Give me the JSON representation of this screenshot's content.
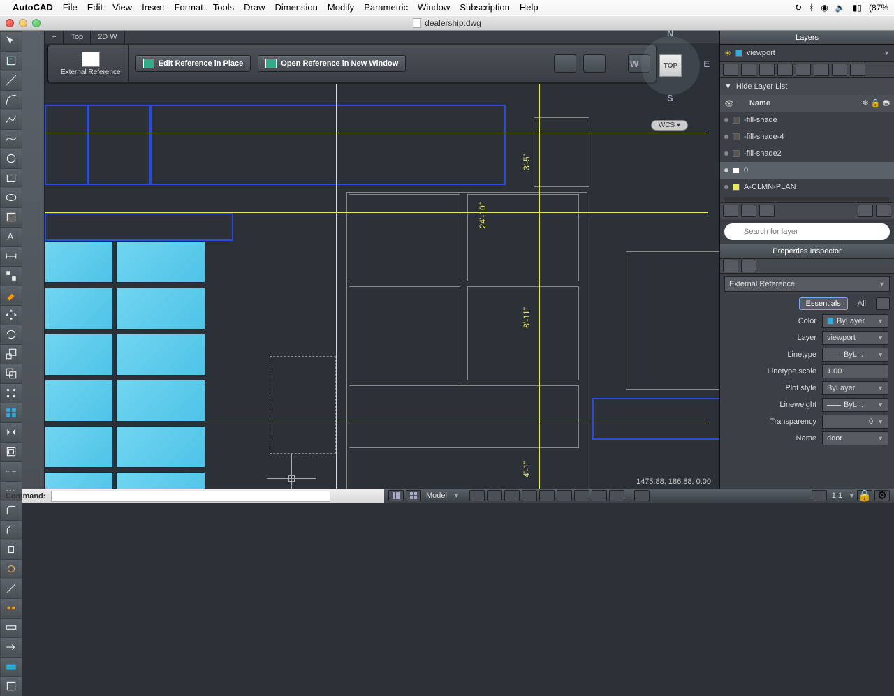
{
  "mac_menu": {
    "app": "AutoCAD",
    "items": [
      "File",
      "Edit",
      "View",
      "Insert",
      "Format",
      "Tools",
      "Draw",
      "Dimension",
      "Modify",
      "Parametric",
      "Window",
      "Subscription",
      "Help"
    ],
    "battery": "(87%"
  },
  "window": {
    "filename": "dealership.dwg"
  },
  "tabs": {
    "add": "+",
    "t1": "Top",
    "t2": "2D W"
  },
  "ref_bar": {
    "group_label": "External Reference",
    "edit_in_place": "Edit Reference in Place",
    "open_new_window": "Open Reference in New Window"
  },
  "viewcube": {
    "top": "TOP",
    "n": "N",
    "s": "S",
    "e": "E",
    "w": "W",
    "wcs": "WCS"
  },
  "coord": "1475.88, 186.88, 0.00",
  "dims": {
    "d1": "3'-5\"",
    "d2": "24'-10\"",
    "d3": "8'-11\"",
    "d4": "4'-1\""
  },
  "layers_panel": {
    "title": "Layers",
    "current": "viewport",
    "toggle": "Hide Layer List",
    "col_name": "Name",
    "items": [
      {
        "name": "-fill-shade",
        "color": "#555"
      },
      {
        "name": "-fill-shade-4",
        "color": "#555"
      },
      {
        "name": "-fill-shade2",
        "color": "#555"
      },
      {
        "name": "0",
        "color": "#fff"
      },
      {
        "name": "A-CLMN-PLAN",
        "color": "#e8e858"
      }
    ],
    "search_placeholder": "Search for layer"
  },
  "props": {
    "title": "Properties Inspector",
    "obj_type": "External Reference",
    "tab_essentials": "Essentials",
    "tab_all": "All",
    "rows": {
      "color": {
        "label": "Color",
        "val": "ByLayer",
        "sw": "#3ad"
      },
      "layer": {
        "label": "Layer",
        "val": "viewport"
      },
      "linetype": {
        "label": "Linetype",
        "val": "ByL..."
      },
      "ltscale": {
        "label": "Linetype scale",
        "val": "1.00"
      },
      "plotstyle": {
        "label": "Plot style",
        "val": "ByLayer"
      },
      "lineweight": {
        "label": "Lineweight",
        "val": "ByL..."
      },
      "transparency": {
        "label": "Transparency",
        "val": "0"
      },
      "name": {
        "label": "Name",
        "val": "door"
      }
    }
  },
  "cmd": {
    "label": "Command:"
  },
  "status": {
    "model": "Model",
    "scale": "1:1"
  }
}
